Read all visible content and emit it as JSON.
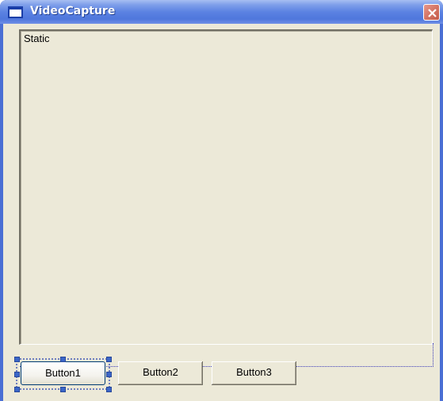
{
  "window": {
    "title": "VideoCapture"
  },
  "static": {
    "label": "Static"
  },
  "buttons": [
    {
      "label": "Button1"
    },
    {
      "label": "Button2"
    },
    {
      "label": "Button3"
    }
  ],
  "icons": {
    "window_icon": "window-icon",
    "close": "close-icon"
  },
  "colors": {
    "titlebar": "#5b82e2",
    "client": "#ece9d8",
    "close_button": "#d47565",
    "selection_handle": "#3b66c8"
  }
}
